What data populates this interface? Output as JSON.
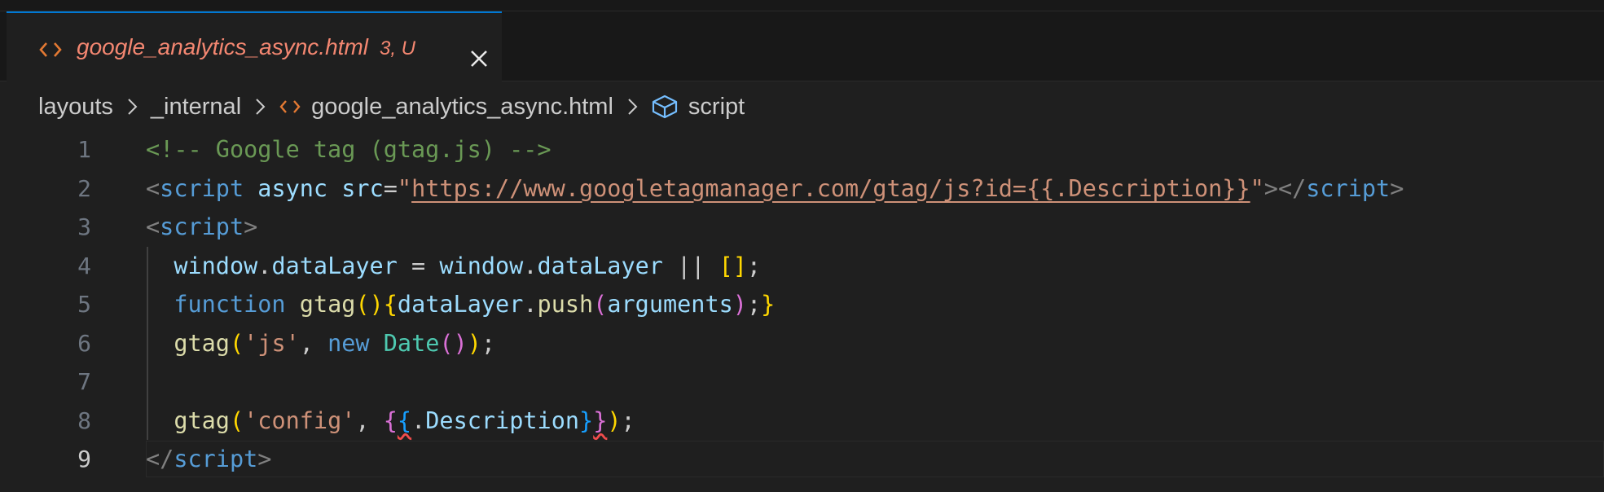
{
  "tab": {
    "filename": "google_analytics_async.html",
    "status": "3, U",
    "icon": "html-code-icon",
    "close_icon": "close-icon"
  },
  "breadcrumb": [
    "layouts",
    "_internal",
    "google_analytics_async.html",
    "script"
  ],
  "colors": {
    "accent": "#0078d4",
    "tab_modified": "#f48771",
    "comment": "#6a9955",
    "tag": "#569cd6",
    "string": "#ce9178",
    "variable": "#9cdcfe",
    "function": "#dcdcaa",
    "class": "#4ec9b0",
    "bracket1": "#ffd700",
    "bracket2": "#da70d6",
    "bracket3": "#179fff"
  },
  "editor": {
    "active_line": 9,
    "lines": [
      {
        "n": "1",
        "tokens": [
          {
            "t": "<!-- Google tag (gtag.js) -->",
            "c": "c-com"
          }
        ]
      },
      {
        "n": "2",
        "tokens": [
          {
            "t": "<",
            "c": "c-pun"
          },
          {
            "t": "script",
            "c": "c-tag"
          },
          {
            "t": " ",
            "c": "c-txt"
          },
          {
            "t": "async",
            "c": "c-attr"
          },
          {
            "t": " ",
            "c": "c-txt"
          },
          {
            "t": "src",
            "c": "c-attr"
          },
          {
            "t": "=",
            "c": "c-txt"
          },
          {
            "t": "\"",
            "c": "c-str"
          },
          {
            "t": "https://www.googletagmanager.com/gtag/js?id={{.Description}}",
            "c": "c-url"
          },
          {
            "t": "\"",
            "c": "c-str"
          },
          {
            "t": "></",
            "c": "c-pun"
          },
          {
            "t": "script",
            "c": "c-tag"
          },
          {
            "t": ">",
            "c": "c-pun"
          }
        ]
      },
      {
        "n": "3",
        "tokens": [
          {
            "t": "<",
            "c": "c-pun"
          },
          {
            "t": "script",
            "c": "c-tag"
          },
          {
            "t": ">",
            "c": "c-pun"
          }
        ]
      },
      {
        "n": "4",
        "tokens": [
          {
            "t": "  ",
            "c": "c-txt"
          },
          {
            "t": "window",
            "c": "c-var"
          },
          {
            "t": ".",
            "c": "c-txt"
          },
          {
            "t": "dataLayer",
            "c": "c-var"
          },
          {
            "t": " = ",
            "c": "c-txt"
          },
          {
            "t": "window",
            "c": "c-var"
          },
          {
            "t": ".",
            "c": "c-txt"
          },
          {
            "t": "dataLayer",
            "c": "c-var"
          },
          {
            "t": " || ",
            "c": "c-txt"
          },
          {
            "t": "[]",
            "c": "c-b1"
          },
          {
            "t": ";",
            "c": "c-txt"
          }
        ]
      },
      {
        "n": "5",
        "tokens": [
          {
            "t": "  ",
            "c": "c-txt"
          },
          {
            "t": "function",
            "c": "c-kw"
          },
          {
            "t": " ",
            "c": "c-txt"
          },
          {
            "t": "gtag",
            "c": "c-fn"
          },
          {
            "t": "()",
            "c": "c-b1"
          },
          {
            "t": "{",
            "c": "c-b1"
          },
          {
            "t": "dataLayer",
            "c": "c-var"
          },
          {
            "t": ".",
            "c": "c-txt"
          },
          {
            "t": "push",
            "c": "c-fn"
          },
          {
            "t": "(",
            "c": "c-b2"
          },
          {
            "t": "arguments",
            "c": "c-var"
          },
          {
            "t": ")",
            "c": "c-b2"
          },
          {
            "t": ";",
            "c": "c-txt"
          },
          {
            "t": "}",
            "c": "c-b1"
          }
        ]
      },
      {
        "n": "6",
        "tokens": [
          {
            "t": "  ",
            "c": "c-txt"
          },
          {
            "t": "gtag",
            "c": "c-fn"
          },
          {
            "t": "(",
            "c": "c-b1"
          },
          {
            "t": "'js'",
            "c": "c-str"
          },
          {
            "t": ", ",
            "c": "c-txt"
          },
          {
            "t": "new",
            "c": "c-kw"
          },
          {
            "t": " ",
            "c": "c-txt"
          },
          {
            "t": "Date",
            "c": "c-cls"
          },
          {
            "t": "()",
            "c": "c-b2"
          },
          {
            "t": ")",
            "c": "c-b1"
          },
          {
            "t": ";",
            "c": "c-txt"
          }
        ]
      },
      {
        "n": "7",
        "tokens": []
      },
      {
        "n": "8",
        "tokens": [
          {
            "t": "  ",
            "c": "c-txt"
          },
          {
            "t": "gtag",
            "c": "c-fn"
          },
          {
            "t": "(",
            "c": "c-b1"
          },
          {
            "t": "'config'",
            "c": "c-str"
          },
          {
            "t": ", ",
            "c": "c-txt"
          },
          {
            "t": "{",
            "c": "c-b2"
          },
          {
            "t": "{",
            "c": "c-b3 c-err"
          },
          {
            "t": ".",
            "c": "c-txt"
          },
          {
            "t": "Description",
            "c": "c-var"
          },
          {
            "t": "}",
            "c": "c-b3"
          },
          {
            "t": "}",
            "c": "c-b2 c-err"
          },
          {
            "t": ")",
            "c": "c-b1"
          },
          {
            "t": ";",
            "c": "c-txt"
          }
        ]
      },
      {
        "n": "9",
        "tokens": [
          {
            "t": "</",
            "c": "c-pun"
          },
          {
            "t": "script",
            "c": "c-tag"
          },
          {
            "t": ">",
            "c": "c-pun"
          }
        ]
      }
    ]
  }
}
